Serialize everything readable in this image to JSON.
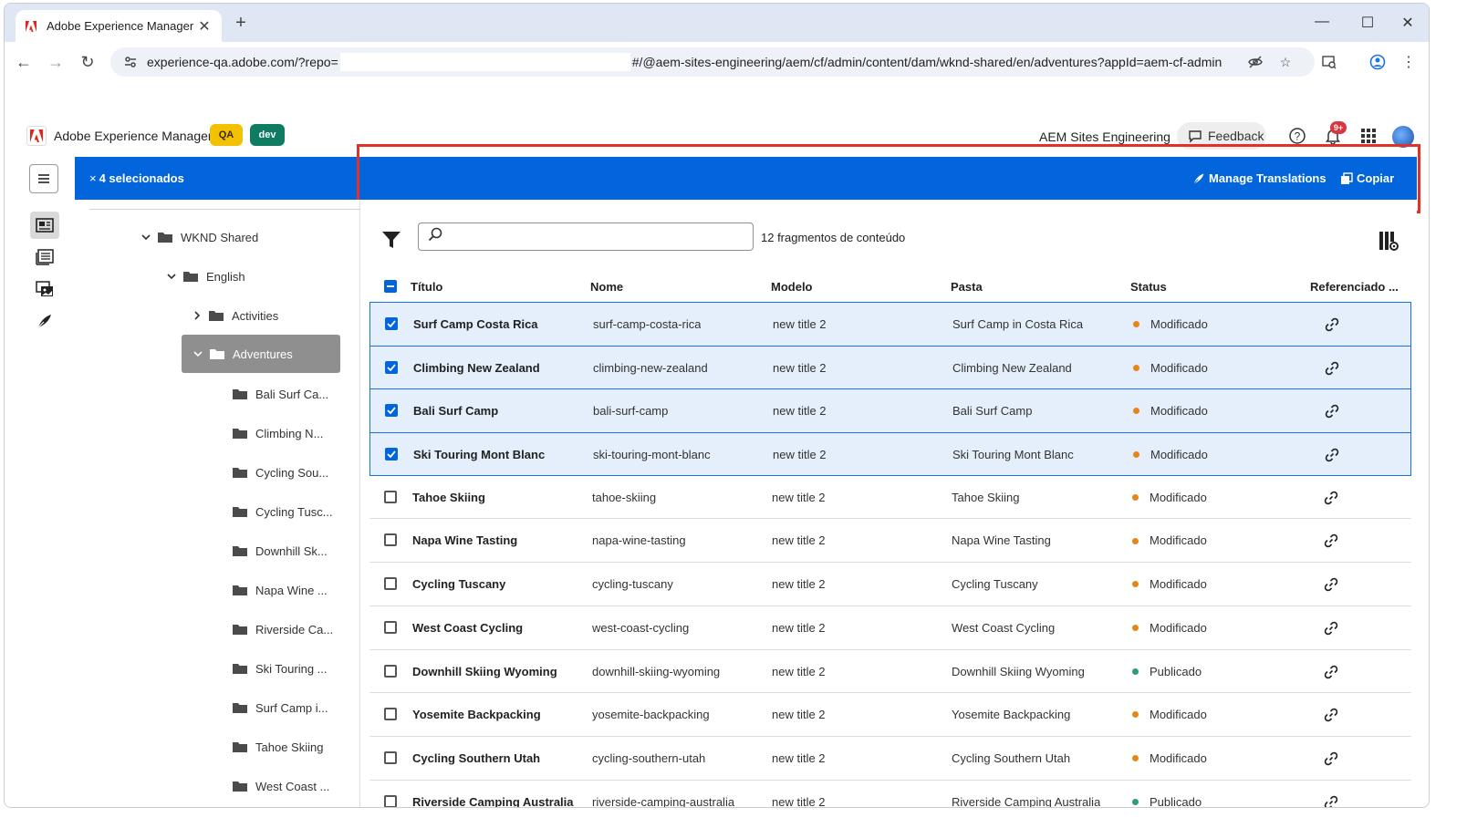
{
  "browser": {
    "tab_title": "Adobe Experience Manager",
    "url_part1": "experience-qa.adobe.com/?repo=",
    "url_part2": "#/@aem-sites-engineering/aem/cf/admin/content/dam/wknd-shared/en/adventures?appId=aem-cf-admin"
  },
  "header": {
    "app_title": "Adobe Experience Manager",
    "badge_qa": "QA",
    "badge_dev": "dev",
    "org": "AEM Sites Engineering",
    "feedback": "Feedback",
    "notifications_count": "9+"
  },
  "selection_bar": {
    "count_label": "4 selecionados",
    "close_glyph": "×",
    "manage_translations": "Manage Translations",
    "copy": "Copiar"
  },
  "tree": {
    "root": "WKND Shared",
    "lang": "English",
    "activities": "Activities",
    "adventures": "Adventures",
    "children": [
      "Bali Surf Ca...",
      "Climbing N...",
      "Cycling Sou...",
      "Cycling Tusc...",
      "Downhill Sk...",
      "Napa Wine ...",
      "Riverside Ca...",
      "Ski Touring ...",
      "Surf Camp i...",
      "Tahoe Skiing",
      "West Coast ..."
    ]
  },
  "toolbar": {
    "search_placeholder": "",
    "count": "12 fragmentos de conteúdo"
  },
  "table": {
    "headers": {
      "title": "Título",
      "name": "Nome",
      "model": "Modelo",
      "folder": "Pasta",
      "status": "Status",
      "ref": "Referenciado ..."
    },
    "rows": [
      {
        "title": "Surf Camp Costa Rica",
        "name": "surf-camp-costa-rica",
        "model": "new title 2",
        "folder": "Surf Camp in Costa Rica",
        "status": "Modificado",
        "selected": true
      },
      {
        "title": "Climbing New Zealand",
        "name": "climbing-new-zealand",
        "model": "new title 2",
        "folder": "Climbing New Zealand",
        "status": "Modificado",
        "selected": true
      },
      {
        "title": "Bali Surf Camp",
        "name": "bali-surf-camp",
        "model": "new title 2",
        "folder": "Bali Surf Camp",
        "status": "Modificado",
        "selected": true
      },
      {
        "title": "Ski Touring Mont Blanc",
        "name": "ski-touring-mont-blanc",
        "model": "new title 2",
        "folder": "Ski Touring Mont Blanc",
        "status": "Modificado",
        "selected": true
      },
      {
        "title": "Tahoe Skiing",
        "name": "tahoe-skiing",
        "model": "new title 2",
        "folder": "Tahoe Skiing",
        "status": "Modificado",
        "selected": false
      },
      {
        "title": "Napa Wine Tasting",
        "name": "napa-wine-tasting",
        "model": "new title 2",
        "folder": "Napa Wine Tasting",
        "status": "Modificado",
        "selected": false
      },
      {
        "title": "Cycling Tuscany",
        "name": "cycling-tuscany",
        "model": "new title 2",
        "folder": "Cycling Tuscany",
        "status": "Modificado",
        "selected": false
      },
      {
        "title": "West Coast Cycling",
        "name": "west-coast-cycling",
        "model": "new title 2",
        "folder": "West Coast Cycling",
        "status": "Modificado",
        "selected": false
      },
      {
        "title": "Downhill Skiing Wyoming",
        "name": "downhill-skiing-wyoming",
        "model": "new title 2",
        "folder": "Downhill Skiing Wyoming",
        "status": "Publicado",
        "selected": false
      },
      {
        "title": "Yosemite Backpacking",
        "name": "yosemite-backpacking",
        "model": "new title 2",
        "folder": "Yosemite Backpacking",
        "status": "Modificado",
        "selected": false
      },
      {
        "title": "Cycling Southern Utah",
        "name": "cycling-southern-utah",
        "model": "new title 2",
        "folder": "Cycling Southern Utah",
        "status": "Modificado",
        "selected": false
      },
      {
        "title": "Riverside Camping Australia",
        "name": "riverside-camping-australia",
        "model": "new title 2",
        "folder": "Riverside Camping Australia",
        "status": "Publicado",
        "selected": false
      }
    ]
  },
  "colors": {
    "accent": "#0265dc",
    "modified": "#e68619",
    "published": "#2d9d78",
    "highlight": "#e0322b"
  }
}
